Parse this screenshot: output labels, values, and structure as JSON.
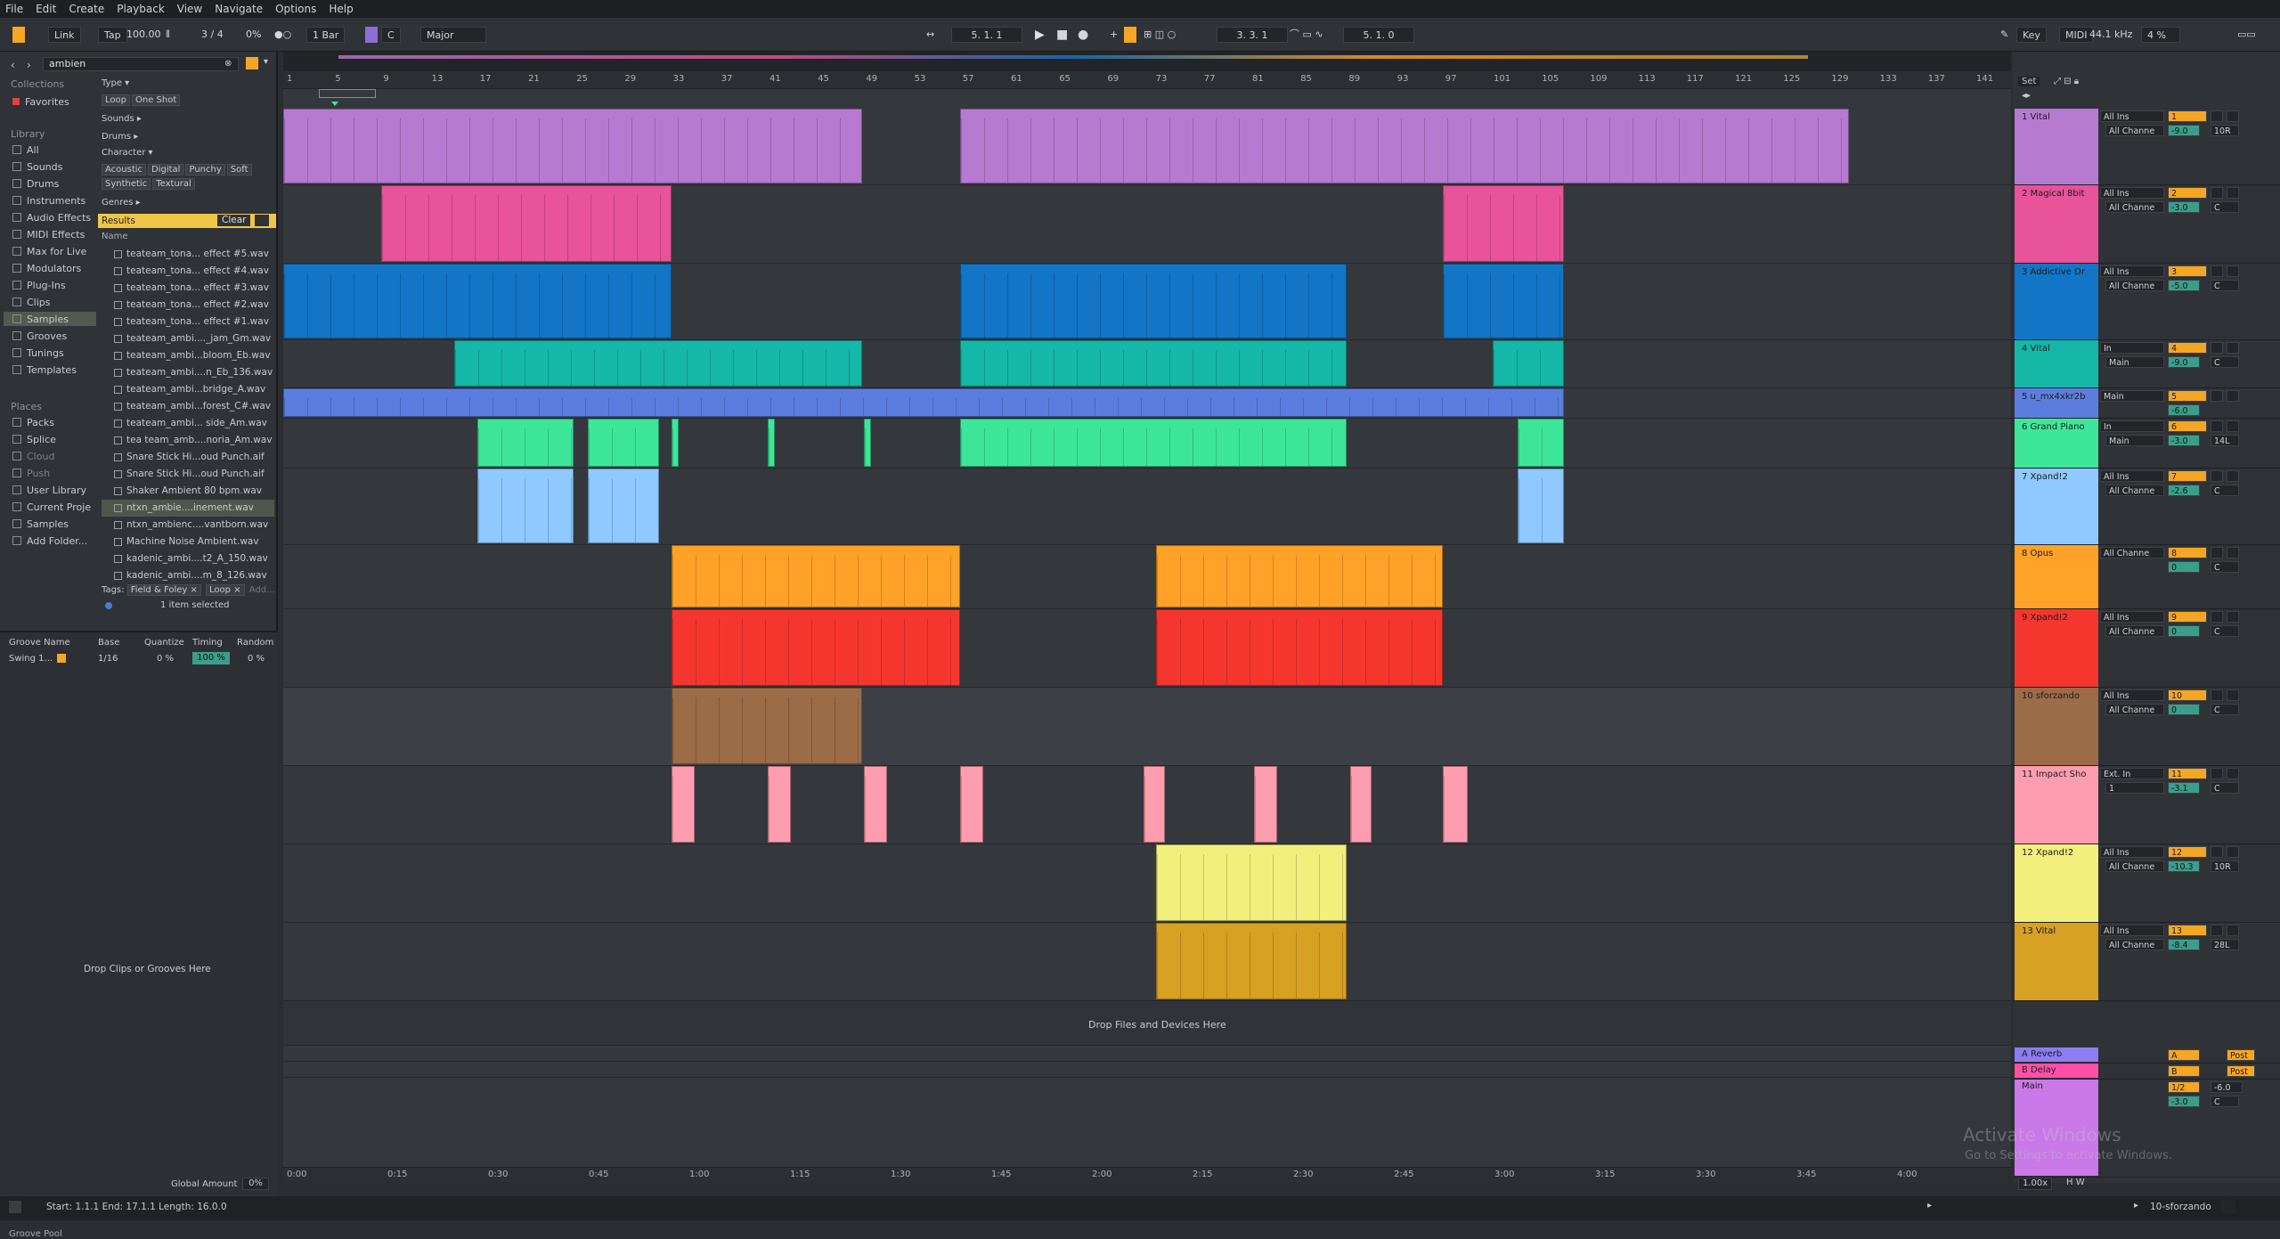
{
  "menu": [
    "File",
    "Edit",
    "Create",
    "Playback",
    "View",
    "Navigate",
    "Options",
    "Help"
  ],
  "control": {
    "link": "Link",
    "tap": "Tap",
    "tempo": "100.00",
    "signature": "3 / 4",
    "swing": "0%",
    "quantize": "1 Bar",
    "key": "C",
    "scale": "Major",
    "position": "5.  1.  1",
    "loop_start": "3.  3.  1",
    "loop_length": "5.  1.  0",
    "key_label": "Key",
    "midi_label": "MIDI",
    "sample_rate": "44.1 kHz",
    "cpu": "4 %"
  },
  "browser": {
    "search": "ambien",
    "collections_label": "Collections",
    "favorites": "Favorites",
    "library_label": "Library",
    "library": [
      "All",
      "Sounds",
      "Drums",
      "Instruments",
      "Audio Effects",
      "MIDI Effects",
      "Max for Live",
      "Modulators",
      "Plug-Ins",
      "Clips",
      "Samples",
      "Grooves",
      "Tunings",
      "Templates"
    ],
    "places_label": "Places",
    "places": [
      "Packs",
      "Splice",
      "Cloud",
      "Push",
      "User Library",
      "Current Proje",
      "Samples",
      "Add Folder..."
    ],
    "filters": {
      "type_label": "Type",
      "type_tags": [
        "Loop",
        "One Shot"
      ],
      "sounds": "Sounds",
      "drums": "Drums",
      "character_label": "Character",
      "character_tags": [
        "Acoustic",
        "Digital",
        "Punchy",
        "Soft",
        "Synthetic",
        "Textural"
      ],
      "genres": "Genres"
    },
    "results_label": "Results",
    "clear": "Clear",
    "name_header": "Name",
    "files": [
      "teateam_tona... effect #5.wav",
      "teateam_tona... effect #4.wav",
      "teateam_tona... effect #3.wav",
      "teateam_tona... effect #2.wav",
      "teateam_tona... effect #1.wav",
      "teateam_ambi...._jam_Gm.wav",
      "teateam_ambi...bloom_Eb.wav",
      "teateam_ambi....n_Eb_136.wav",
      "teateam_ambi...bridge_A.wav",
      "teateam_ambi...forest_C#.wav",
      "teateam_ambi... side_Am.wav",
      "tea team_amb....noria_Am.wav",
      "Snare Stick Hi...oud Punch.aif",
      "Snare Stick Hi...oud Punch.aif",
      "Shaker Ambient 80 bpm.wav",
      "ntxn_ambie....inement.wav",
      "ntxn_ambienc....vantborn.wav",
      "Machine Noise Ambient.wav",
      "kadenic_ambi....t2_A_150.wav",
      "kadenic_ambi....m_8_126.wav"
    ],
    "tags_label": "Tags:",
    "tags": [
      "Field & Foley ×",
      "Loop ×",
      "Add..."
    ],
    "selection": "1 item selected",
    "groove": {
      "headers": [
        "Groove Name",
        "Base",
        "Quantize",
        "Timing",
        "Random"
      ],
      "row": [
        "Swing 1...",
        "1/16",
        "0 %",
        "100 %",
        "0 %"
      ],
      "drop_text": "Drop Clips or Grooves Here",
      "pool": "Groove Pool",
      "global_amount_label": "Global Amount",
      "global_amount": "0%"
    }
  },
  "ruler": [
    "1",
    "5",
    "9",
    "13",
    "17",
    "21",
    "25",
    "29",
    "33",
    "37",
    "41",
    "45",
    "49",
    "53",
    "57",
    "61",
    "65",
    "69",
    "73",
    "77",
    "81",
    "85",
    "89",
    "93",
    "97",
    "101",
    "105",
    "109",
    "113",
    "117",
    "121",
    "125",
    "129",
    "133",
    "137",
    "141"
  ],
  "timeline": [
    "0:00",
    "0:15",
    "0:30",
    "0:45",
    "1:00",
    "1:15",
    "1:30",
    "1:45",
    "2:00",
    "2:15",
    "2:30",
    "2:45",
    "3:00",
    "3:15",
    "3:30",
    "3:45",
    "4:00"
  ],
  "arrangement": {
    "drop_text": "Drop Files and Devices Here",
    "set_label": "Set"
  },
  "tracks": [
    {
      "name": "1 Vital",
      "color": "#b77ad1",
      "input": "All Ins",
      "channel": "All Channe",
      "num": "1",
      "vol": "-9.0",
      "pan": "10R"
    },
    {
      "name": "2 Magical 8bit",
      "color": "#e8539a",
      "input": "All Ins",
      "channel": "All Channe",
      "num": "2",
      "vol": "-3.0",
      "pan": "C"
    },
    {
      "name": "3 Addictive Dr",
      "color": "#1275c6",
      "input": "All Ins",
      "channel": "All Channe",
      "num": "3",
      "vol": "-5.0",
      "pan": "C"
    },
    {
      "name": "4 Vital",
      "color": "#15b7a9",
      "input": "In",
      "channel": "Main",
      "num": "4",
      "vol": "-9.0",
      "pan": "C"
    },
    {
      "name": "5 u_mx4xkr2b",
      "color": "#5c7de0",
      "input": "Main",
      "channel": "",
      "num": "5",
      "vol": "-6.0",
      "pan": ""
    },
    {
      "name": "6 Grand Piano",
      "color": "#3ee69a",
      "input": "In",
      "channel": "Main",
      "num": "6",
      "vol": "-3.0",
      "pan": "14L"
    },
    {
      "name": "7 Xpand!2",
      "color": "#8fc9ff",
      "input": "All Ins",
      "channel": "All Channe",
      "num": "7",
      "vol": "-2.6",
      "pan": "C"
    },
    {
      "name": "8 Opus",
      "color": "#ffa227",
      "input": "All Channe",
      "channel": "",
      "num": "8",
      "vol": "0",
      "pan": "C"
    },
    {
      "name": "9 Xpand!2",
      "color": "#f5362f",
      "input": "All Ins",
      "channel": "All Channe",
      "num": "9",
      "vol": "0",
      "pan": "C"
    },
    {
      "name": "10 sforzando",
      "color": "#9c6b47",
      "input": "All Ins",
      "channel": "All Channe",
      "num": "10",
      "vol": "0",
      "pan": "C"
    },
    {
      "name": "11 Impact Sho",
      "color": "#ff9db0",
      "input": "Ext. In",
      "channel": "1",
      "num": "11",
      "vol": "-3.1",
      "pan": "C"
    },
    {
      "name": "12 Xpand!2",
      "color": "#f2ef7c",
      "input": "All Ins",
      "channel": "All Channe",
      "num": "12",
      "vol": "-10.3",
      "pan": "10R"
    },
    {
      "name": "13 Vital",
      "color": "#d7a124",
      "input": "All Ins",
      "channel": "All Channe",
      "num": "13",
      "vol": "-8.4",
      "pan": "28L"
    }
  ],
  "returns": [
    {
      "name": "A Reverb",
      "color": "#8f7cf0",
      "num": "A",
      "post": "Post"
    },
    {
      "name": "B Delay",
      "color": "#ff4fa8",
      "num": "B",
      "post": "Post"
    },
    {
      "name": "Main",
      "color": "#c979e8",
      "num": "1/2",
      "vol": "-3.0",
      "pan": "C",
      "out": "-6.0"
    }
  ],
  "status": {
    "selection": "Start: 1.1.1  End: 17.1.1  Length: 16.0.0",
    "track": "10-sforzando",
    "zoom": "1.00x",
    "watermark_title": "Activate Windows",
    "watermark_sub": "Go to Settings to activate Windows."
  }
}
